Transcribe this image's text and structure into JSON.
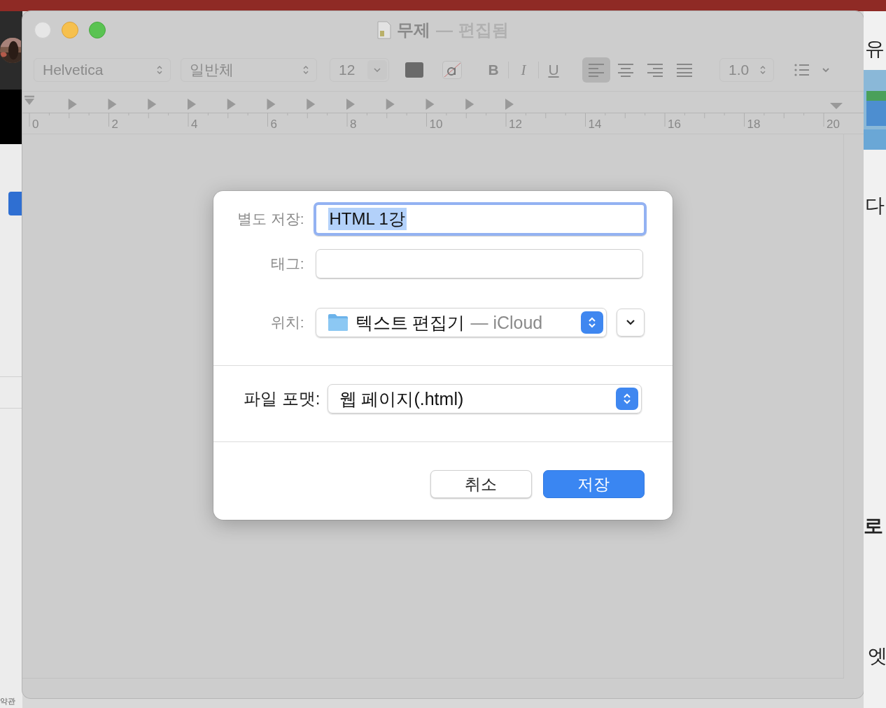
{
  "background": {
    "right_texts": [
      "유",
      "다",
      "로",
      "엣"
    ],
    "bottom_left_text": "약관"
  },
  "window": {
    "title": "무제",
    "separator": "—",
    "status": "편집됨"
  },
  "toolbar": {
    "font": "Helvetica",
    "style": "일반체",
    "size": "12",
    "bold": "B",
    "italic": "I",
    "underline": "U",
    "alignments": [
      {
        "kind": "left",
        "selected": true
      },
      {
        "kind": "center",
        "selected": false
      },
      {
        "kind": "right",
        "selected": false
      },
      {
        "kind": "justify",
        "selected": false
      }
    ],
    "spacing": "1.0"
  },
  "ruler": {
    "labels": [
      "0",
      "2",
      "4",
      "6",
      "8",
      "10",
      "12",
      "14",
      "16",
      "18",
      "20"
    ]
  },
  "dialog": {
    "save_as": {
      "label": "별도 저장:",
      "value": "HTML 1강",
      "focused": true,
      "text_selected": true
    },
    "tags": {
      "label": "태그:"
    },
    "location": {
      "label": "위치:",
      "folder": "텍스트 편집기",
      "suffix": "— iCloud",
      "expanded": false
    },
    "file_format": {
      "label": "파일 포맷:",
      "value": "웹 페이지(.html)"
    },
    "buttons": [
      {
        "label": "취소",
        "kind": "secondary"
      },
      {
        "label": "저장",
        "kind": "primary"
      }
    ]
  }
}
